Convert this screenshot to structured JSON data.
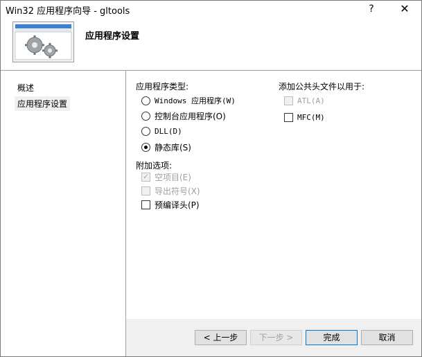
{
  "window": {
    "title": "Win32 应用程序向导 - gltools",
    "help_icon": "?",
    "close_icon": "✕"
  },
  "header": {
    "title": "应用程序设置"
  },
  "sidebar": {
    "items": [
      {
        "label": "概述"
      },
      {
        "label": "应用程序设置"
      }
    ]
  },
  "app_type": {
    "label": "应用程序类型:",
    "options": [
      {
        "label": "Windows 应用程序(W)",
        "checked": false
      },
      {
        "label": "控制台应用程序(O)",
        "checked": false
      },
      {
        "label": "DLL(D)",
        "checked": false
      },
      {
        "label": "静态库(S)",
        "checked": true
      }
    ]
  },
  "extra_options": {
    "label": "附加选项:",
    "options": [
      {
        "label": "空项目(E)",
        "checked": true,
        "disabled": true
      },
      {
        "label": "导出符号(X)",
        "checked": false,
        "disabled": true
      },
      {
        "label": "预编译头(P)",
        "checked": false,
        "disabled": false
      }
    ]
  },
  "common_headers": {
    "label": "添加公共头文件以用于:",
    "options": [
      {
        "label": "ATL(A)",
        "checked": false,
        "disabled": true
      },
      {
        "label": "MFC(M)",
        "checked": false,
        "disabled": false
      }
    ]
  },
  "buttons": {
    "prev": "< 上一步",
    "next": "下一步 >",
    "finish": "完成",
    "cancel": "取消"
  }
}
